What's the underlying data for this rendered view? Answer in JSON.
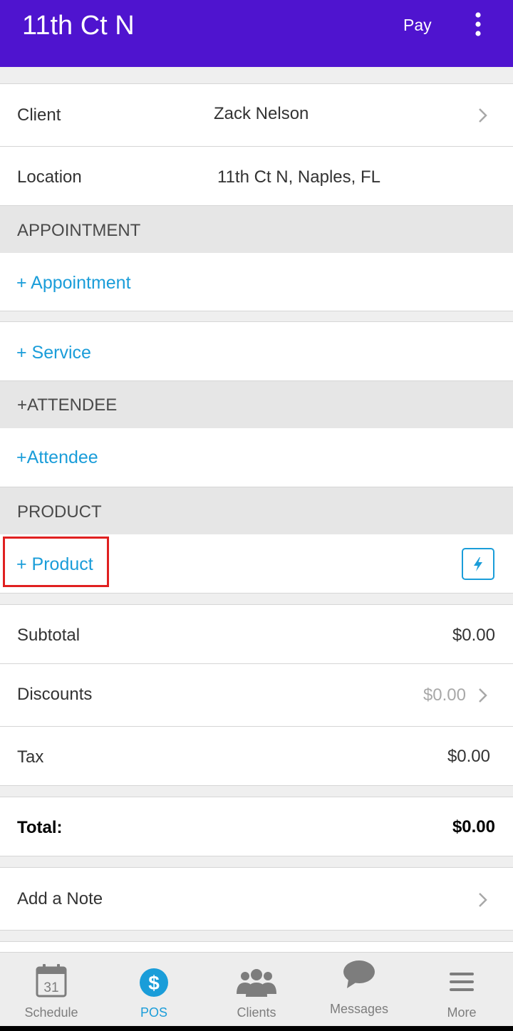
{
  "header": {
    "title": "11th Ct N",
    "pay_label": "Pay",
    "menu_icon": "more-vertical-icon",
    "background_color": "#4f14cf"
  },
  "client": {
    "label": "Client",
    "value": "Zack Nelson"
  },
  "location": {
    "label": "Location",
    "value": "11th Ct N, Naples, FL"
  },
  "appointment_section": {
    "header": "APPOINTMENT",
    "add_label": "+ Appointment"
  },
  "service": {
    "add_label": "+ Service"
  },
  "attendee_section": {
    "header": "+ATTENDEE",
    "add_label": "+Attendee"
  },
  "product_section": {
    "header": "PRODUCT",
    "add_label": "+ Product",
    "quick_icon": "lightning-icon"
  },
  "totals": {
    "subtotal_label": "Subtotal",
    "subtotal_value": "$0.00",
    "discounts_label": "Discounts",
    "discounts_value": "$0.00",
    "tax_label": "Tax",
    "tax_value": "$0.00",
    "total_label": "Total:",
    "total_value": "$0.00"
  },
  "note": {
    "label": "Add a Note"
  },
  "bottom_nav": {
    "items": [
      {
        "label": "Schedule",
        "icon": "calendar-icon",
        "calendar_day": "31"
      },
      {
        "label": "POS",
        "icon": "dollar-icon",
        "active": true
      },
      {
        "label": "Clients",
        "icon": "clients-icon"
      },
      {
        "label": "Messages",
        "icon": "chat-icon"
      },
      {
        "label": "More",
        "icon": "hamburger-icon"
      }
    ]
  },
  "colors": {
    "accent": "#1a9dd9",
    "highlight": "#e02020",
    "text": "#333333"
  }
}
